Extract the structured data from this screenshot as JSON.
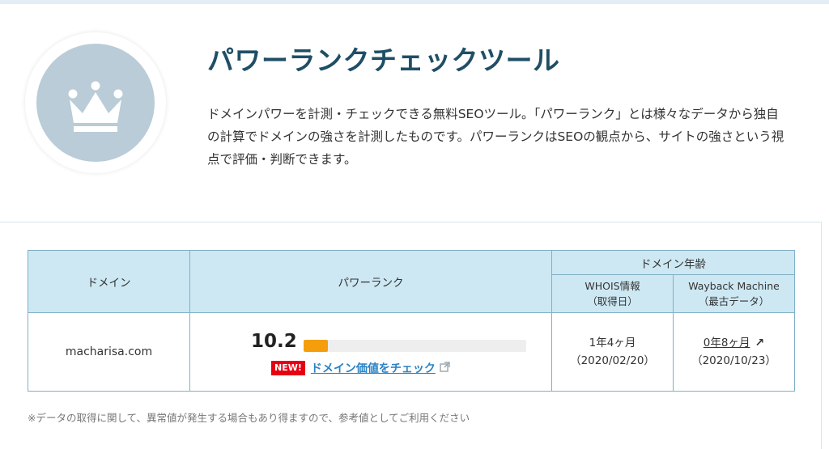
{
  "hero": {
    "icon": "crown-icon",
    "title": "パワーランクチェックツール",
    "description": "ドメインパワーを計測・チェックできる無料SEOツール。「パワーランク」とは様々なデータから独自の計算でドメインの強さを計測したものです。パワーランクはSEOの観点から、サイトの強さという視点で評価・判断できます。"
  },
  "table": {
    "headers": {
      "domain": "ドメイン",
      "power_rank": "パワーランク",
      "domain_age": "ドメイン年齢",
      "whois_line1": "WHOIS情報",
      "whois_line2": "（取得日）",
      "wayback_line1": "Wayback Machine",
      "wayback_line2": "（最古データ）"
    },
    "row": {
      "domain": "macharisa.com",
      "power_rank": "10.2",
      "power_rank_fill": 0.11,
      "new_badge": "NEW!",
      "check_link": "ドメイン価値をチェック",
      "whois_age": "1年4ヶ月",
      "whois_date": "（2020/02/20）",
      "wayback_age": "0年8ヶ月",
      "wayback_date": "（2020/10/23）"
    }
  },
  "note": "※データの取得に関して、異常値が発生する場合もあり得ますので、参考値としてご利用ください",
  "colors": {
    "title": "#1f4e66",
    "header_bg": "#cde8f3",
    "bar_fill": "#f59e0b",
    "new_badge": "#e60012",
    "link": "#2a83c6"
  }
}
